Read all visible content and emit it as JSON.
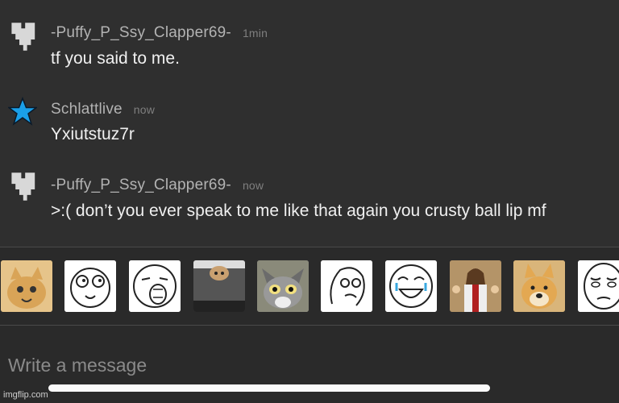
{
  "messages": [
    {
      "user": "-Puffy_P_Ssy_Clapper69-",
      "time": "1min",
      "text": "tf you said to me.",
      "avatar": "heart-pixel-icon"
    },
    {
      "user": "Schlattlive",
      "time": "now",
      "text": "Yxiutstuz7r",
      "avatar": "blue-star-icon"
    },
    {
      "user": "-Puffy_P_Ssy_Clapper69-",
      "time": "now",
      "text": ">:( don’t you ever speak to me like that again you crusty ball lip mf",
      "avatar": "heart-pixel-icon"
    }
  ],
  "meme_strip": [
    "cat-meme",
    "rage-face-meme",
    "lol-face-meme",
    "ceiling-cat-meme",
    "tom-cat-meme",
    "thinking-face-meme",
    "happy-cry-face-meme",
    "buddy-jesus-meme",
    "doge-meme",
    "okay-face-meme"
  ],
  "composer": {
    "placeholder": "Write a message"
  },
  "watermark": "imgflip.com",
  "colors": {
    "background": "#2f2f2f",
    "username": "#b3b3b3",
    "text": "#f0f0f0",
    "star": "#1a9fe8"
  }
}
